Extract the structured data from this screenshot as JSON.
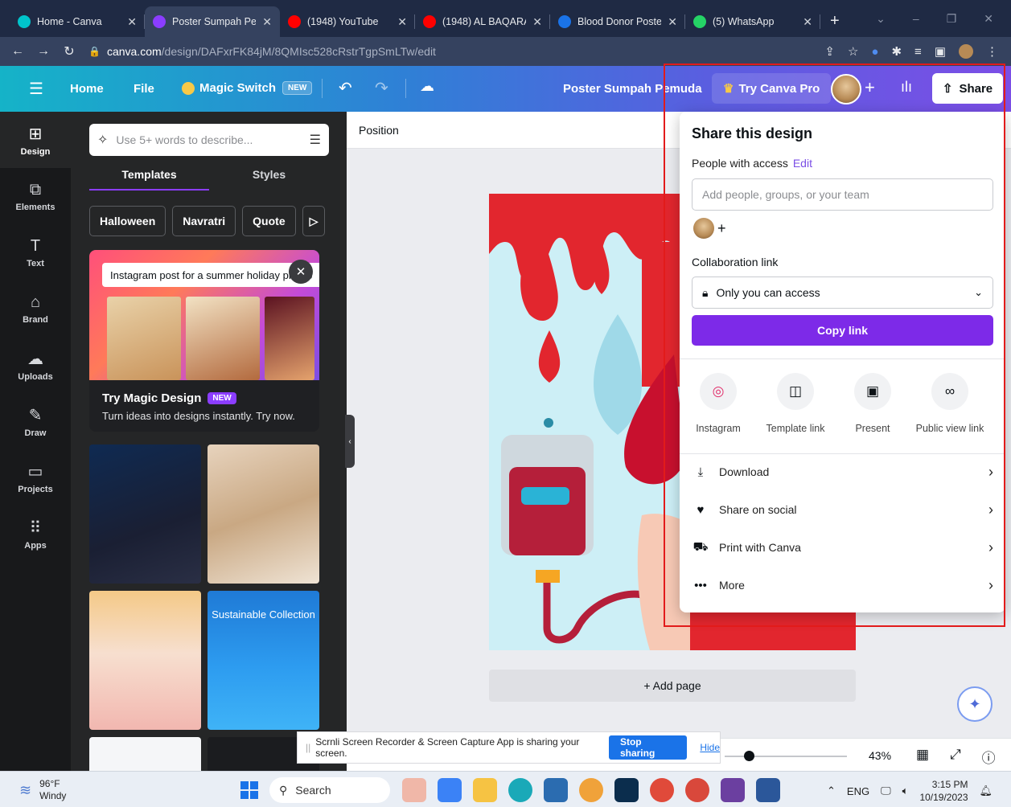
{
  "browser": {
    "tabs": [
      {
        "title": "Home - Canva",
        "color": "#00c4cc",
        "active": false
      },
      {
        "title": "Poster Sumpah Pe",
        "color": "#8b3dff",
        "active": true
      },
      {
        "title": "(1948) YouTube",
        "color": "#ff0000",
        "active": false
      },
      {
        "title": "(1948) AL BAQARA",
        "color": "#ff0000",
        "active": false
      },
      {
        "title": "Blood Donor Poste",
        "color": "#1a73e8",
        "active": false
      },
      {
        "title": "(5) WhatsApp",
        "color": "#25d366",
        "active": false
      }
    ],
    "new_tab": "+",
    "url_host": "canva.com",
    "url_path": "/design/DAFxrFK84jM/8QMIsc528cRstrTgpSmLTw/edit"
  },
  "header": {
    "home": "Home",
    "file": "File",
    "magic_switch": "Magic Switch",
    "new_badge": "NEW",
    "doc_title": "Poster Sumpah Pemuda",
    "try_pro": "Try Canva Pro",
    "share": "Share"
  },
  "rail": [
    {
      "label": "Design",
      "icon": "layout-icon",
      "glyph": "⊞"
    },
    {
      "label": "Elements",
      "icon": "shapes-icon",
      "glyph": "⧉"
    },
    {
      "label": "Text",
      "icon": "text-icon",
      "glyph": "T"
    },
    {
      "label": "Brand",
      "icon": "brand-icon",
      "glyph": "⌂"
    },
    {
      "label": "Uploads",
      "icon": "upload-cloud-icon",
      "glyph": "☁"
    },
    {
      "label": "Draw",
      "icon": "pen-icon",
      "glyph": "✎"
    },
    {
      "label": "Projects",
      "icon": "folder-icon",
      "glyph": "▭"
    },
    {
      "label": "Apps",
      "icon": "apps-grid-icon",
      "glyph": "⠿"
    }
  ],
  "panel": {
    "search_placeholder": "Use 5+ words to describe...",
    "tab_templates": "Templates",
    "tab_styles": "Styles",
    "chips": [
      "Halloween",
      "Navratri",
      "Quote"
    ],
    "promo_input": "Instagram post for a summer holiday promo",
    "promo_title": "Try Magic Design",
    "promo_new": "NEW",
    "promo_sub": "Turn ideas into designs instantly. Try now.",
    "template_text": "Sustainable Collection"
  },
  "canvas": {
    "position_label": "Position",
    "add_page": "+ Add page",
    "zoom": "43%",
    "zoom_fraction": 0.2
  },
  "screenshare": {
    "message": "Scrnli Screen Recorder & Screen Capture App is sharing your screen.",
    "stop": "Stop sharing",
    "hide": "Hide"
  },
  "share_panel": {
    "title": "Share this design",
    "people_access": "People with access",
    "edit": "Edit",
    "add_placeholder": "Add people, groups, or your team",
    "collab_link": "Collaboration link",
    "access_value": "Only you can access",
    "copy_link": "Copy link",
    "tiles": [
      {
        "label": "Instagram",
        "icon": "instagram-icon"
      },
      {
        "label": "Template link",
        "icon": "template-icon"
      },
      {
        "label": "Present",
        "icon": "present-icon"
      },
      {
        "label": "Public view link",
        "icon": "link-icon"
      }
    ],
    "rows": [
      {
        "label": "Download",
        "icon": "download-icon"
      },
      {
        "label": "Share on social",
        "icon": "heart-icon"
      },
      {
        "label": "Print with Canva",
        "icon": "truck-icon"
      },
      {
        "label": "More",
        "icon": "more-icon"
      }
    ]
  },
  "taskbar": {
    "temp": "96°F",
    "weather": "Windy",
    "search": "Search",
    "lang": "ENG",
    "time": "3:15 PM",
    "date": "10/19/2023"
  }
}
